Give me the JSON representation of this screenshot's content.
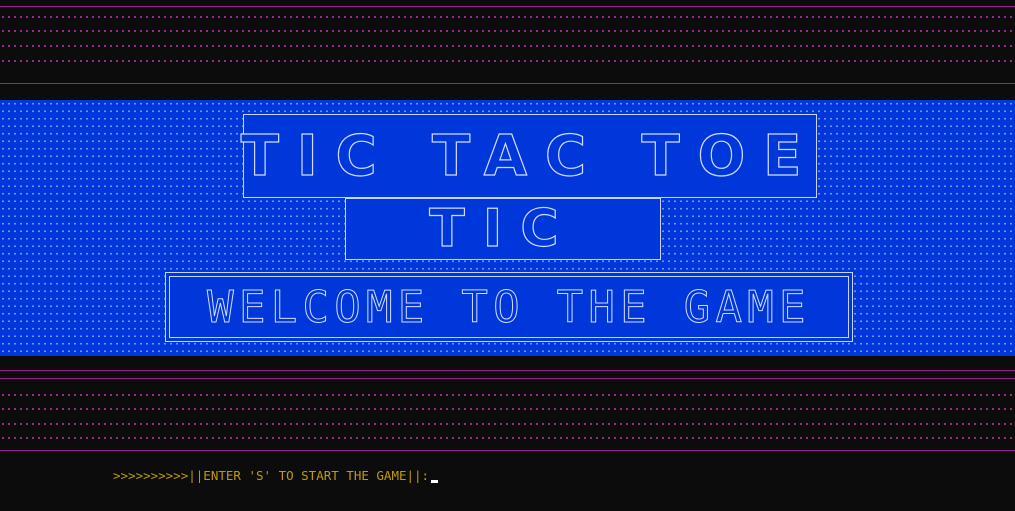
{
  "banner": {
    "art_line1": "TIC TAC TOE",
    "art_line2": "TIC",
    "art_line3": "WELCOME TO THE GAME"
  },
  "prompt": {
    "text": ">>>>>>>>>>||ENTER 'S' TO START THE GAME||:"
  },
  "colors": {
    "background": "#0c0c0c",
    "banner_blue": "#0037da",
    "band_magenta": "#b12ea3",
    "prompt_yellow": "#c19c00"
  }
}
